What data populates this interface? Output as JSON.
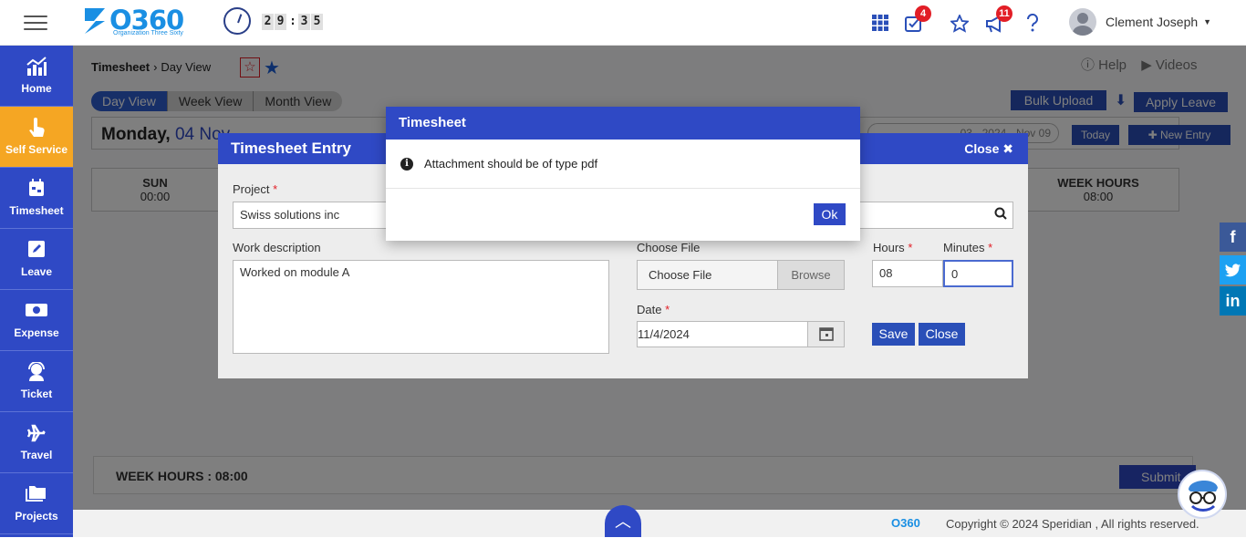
{
  "app": {
    "logo_text": "O360",
    "logo_subtitle": "Organization Three Sixty",
    "timer": [
      "2",
      "9",
      ":",
      "3",
      "5"
    ]
  },
  "topbar": {
    "tasks_badge": "4",
    "announcements_badge": "11",
    "user_name": "Clement Joseph"
  },
  "sidebar": {
    "items": [
      {
        "label": "Home"
      },
      {
        "label": "Self Service"
      },
      {
        "label": "Timesheet"
      },
      {
        "label": "Leave"
      },
      {
        "label": "Expense"
      },
      {
        "label": "Ticket"
      },
      {
        "label": "Travel"
      },
      {
        "label": "Projects"
      }
    ]
  },
  "breadcrumb": {
    "root": "Timesheet",
    "current": "Day View"
  },
  "links": {
    "help": "Help",
    "videos": "Videos"
  },
  "view_tabs": [
    "Day View",
    "Week View",
    "Month View"
  ],
  "actions": {
    "bulk_upload": "Bulk Upload",
    "apply_leave": "Apply Leave",
    "today": "Today",
    "new_entry": "New Entry",
    "date_range": "03 · 2024 · Nov 09"
  },
  "day_header": {
    "weekday": "Monday,",
    "date": "04 Nov"
  },
  "week": {
    "sun_label": "SUN",
    "sun_hours": "00:00",
    "week_hours_label": "WEEK HOURS",
    "week_hours_value": "08:00"
  },
  "footer_bar": {
    "week_hours": "WEEK HOURS  : 08:00",
    "submit": "Submit"
  },
  "entry": {
    "title": "Timesheet Entry",
    "close": "Close",
    "project_label": "Project",
    "project_value": "Swiss solutions inc",
    "work_label": "Work description",
    "work_value": "Worked on module A",
    "file_label": "Choose File",
    "file_button": "Choose File",
    "browse": "Browse",
    "hours_label": "Hours",
    "hours_value": "08",
    "minutes_label": "Minutes",
    "minutes_value": "0",
    "date_label": "Date",
    "date_value": "11/4/2024",
    "save": "Save",
    "close_button": "Close"
  },
  "modal": {
    "title": "Timesheet",
    "message": "Attachment should be of type pdf",
    "ok": "Ok"
  },
  "footer": {
    "copyright": "Copyright © 2024 Speridian , All rights reserved."
  }
}
